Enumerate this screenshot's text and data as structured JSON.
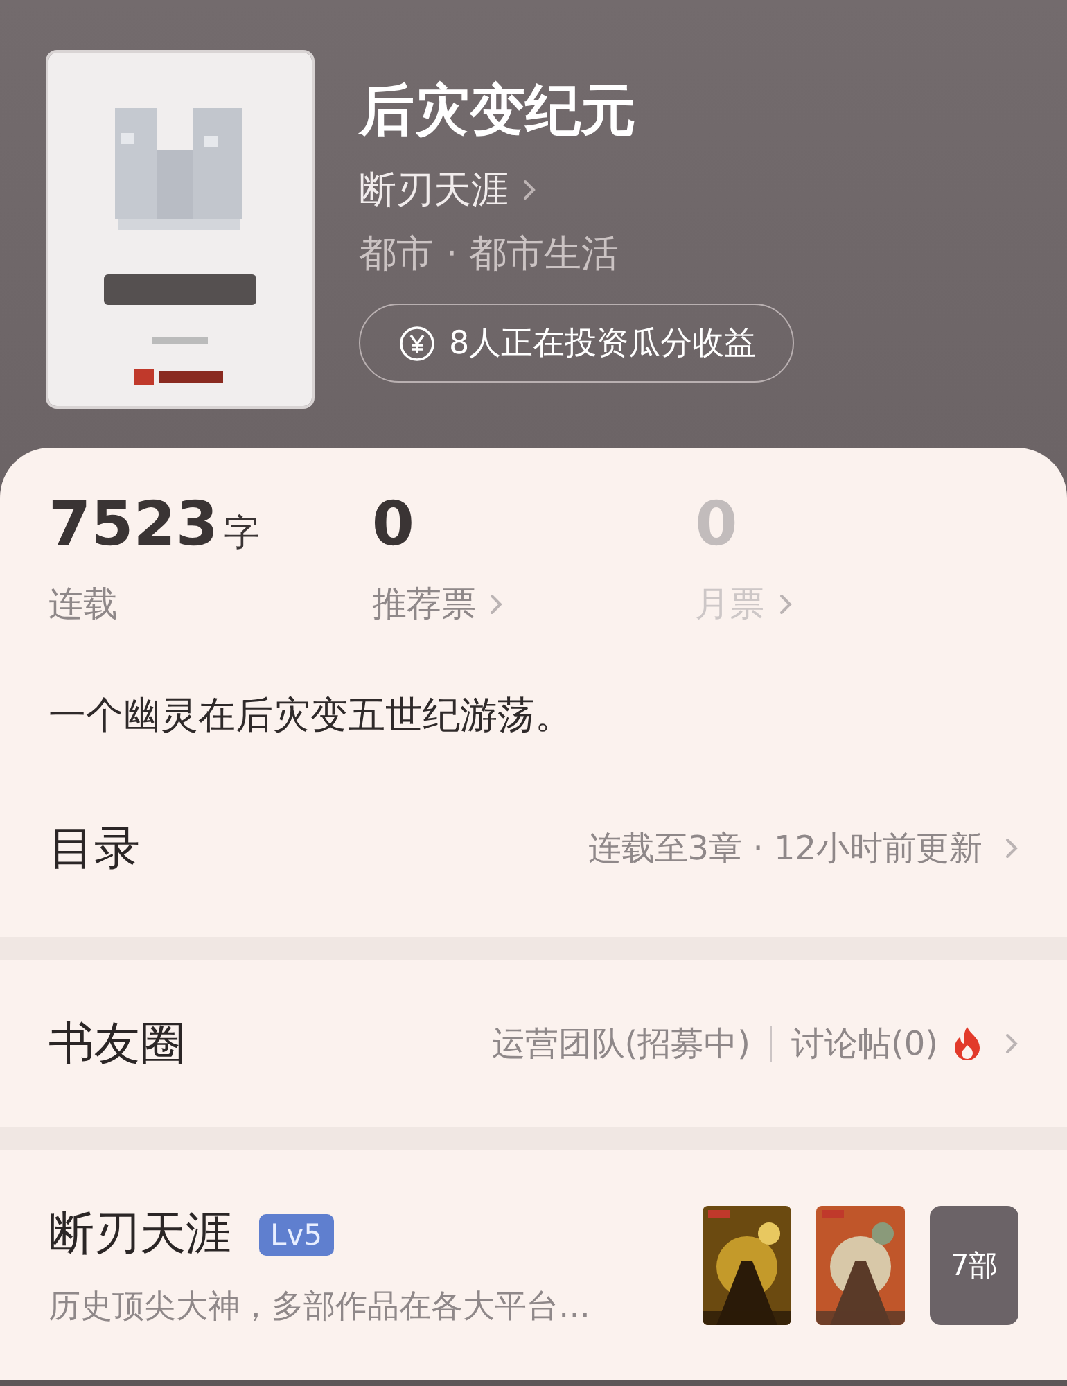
{
  "book": {
    "title": "后灾变纪元",
    "author": "断刃天涯",
    "category": "都市 · 都市生活",
    "invest": "8人正在投资瓜分收益"
  },
  "stats": [
    {
      "value": "7523",
      "unit": "字",
      "label": "连载",
      "link": false,
      "disabled": false
    },
    {
      "value": "0",
      "label": "推荐票",
      "link": true,
      "disabled": false
    },
    {
      "value": "0",
      "label": "月票",
      "link": true,
      "disabled": true
    }
  ],
  "description": "一个幽灵在后灾变五世纪游荡。",
  "catalog": {
    "title": "目录",
    "info": "连载至3章 · 12小时前更新"
  },
  "community": {
    "title": "书友圈",
    "team": "运营团队(招募中)",
    "posts": "讨论帖(0)",
    "hot": true
  },
  "author_card": {
    "name": "断刃天涯",
    "level": "Lv5",
    "intro": "历史顶尖大神，多部作品在各大平台…",
    "works_count": "7部"
  }
}
